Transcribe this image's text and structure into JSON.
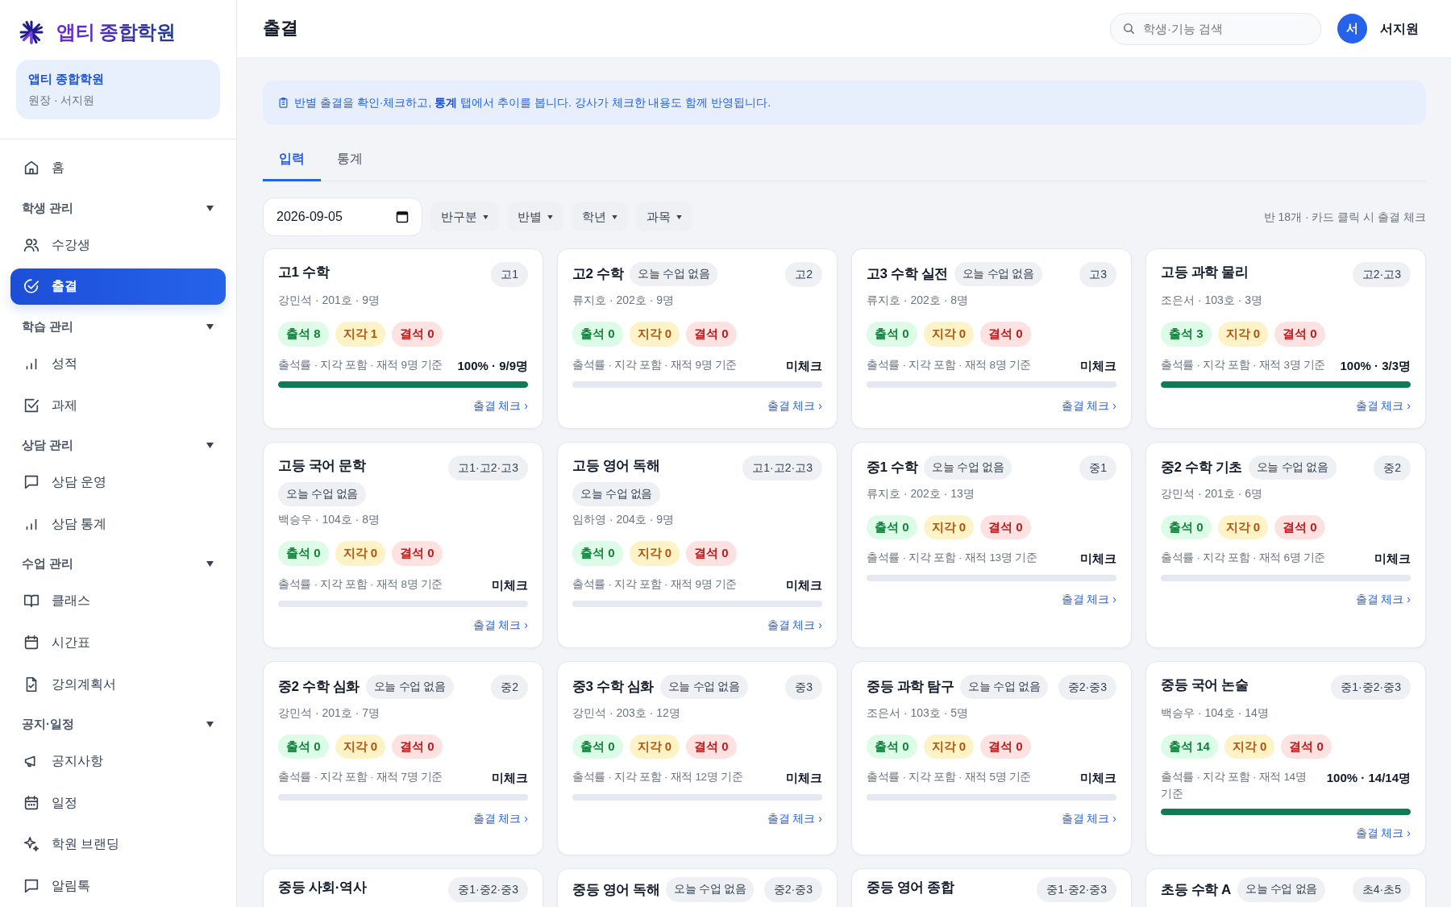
{
  "sidebar": {
    "logo": "앱티 종합학원",
    "org": {
      "name": "앱티 종합학원",
      "role": "원장 · 서지원"
    },
    "nav": [
      {
        "kind": "link",
        "label": "홈",
        "selected": false
      },
      {
        "kind": "section",
        "label": "학생 관리",
        "expanded": true,
        "children": [
          {
            "label": "수강생",
            "selected": false
          },
          {
            "label": "출결",
            "selected": true
          }
        ]
      },
      {
        "kind": "section",
        "label": "학습 관리",
        "expanded": true,
        "children": [
          {
            "label": "성적",
            "selected": false
          },
          {
            "label": "과제",
            "selected": false
          }
        ]
      },
      {
        "kind": "section",
        "label": "상담 관리",
        "expanded": true,
        "children": [
          {
            "label": "상담 운영",
            "selected": false
          },
          {
            "label": "상담 통계",
            "selected": false
          }
        ]
      },
      {
        "kind": "section",
        "label": "수업 관리",
        "expanded": true,
        "children": [
          {
            "label": "클래스",
            "selected": false
          },
          {
            "label": "시간표",
            "selected": false
          },
          {
            "label": "강의계획서",
            "selected": false
          }
        ]
      },
      {
        "kind": "section",
        "label": "공지·일정",
        "expanded": true,
        "children": [
          {
            "label": "공지사항",
            "selected": false
          },
          {
            "label": "일정",
            "selected": false
          },
          {
            "label": "학원 브랜딩",
            "selected": false
          },
          {
            "label": "알림톡",
            "selected": false
          }
        ]
      }
    ]
  },
  "header": {
    "title": "출결",
    "search": {
      "placeholder": "학생·기능 검색"
    },
    "user": {
      "avatar": "서",
      "name": "서지원"
    }
  },
  "notice": "반별 출결을 확인·체크하고, **통계** 탭에서 추이를 봅니다. 강사가 체크한 내용도 함께 반영됩니다.",
  "tabs": [
    {
      "label": "입력",
      "selected": true
    },
    {
      "label": "통계",
      "selected": false
    }
  ],
  "filters": {
    "date": "2026-09-05",
    "dropdowns": [
      "반구분",
      "반별",
      "학년",
      "과목"
    ],
    "summary": "반 18개 · 카드 클릭 시 출결 체크"
  },
  "cards": [
    {
      "title": "고1 수학",
      "grade": "고1",
      "meta": "강민석 · 201호 · 9명",
      "counts": [
        {
          "kind": "present",
          "text": "출석 8"
        },
        {
          "kind": "late",
          "text": "지각 1"
        },
        {
          "kind": "absent",
          "text": "결석 0"
        }
      ],
      "basis": "출석률 · 지각 포함 · 재적 9명 기준",
      "result": "100% · 9/9명",
      "level": 1,
      "link": "출결 체크 ›"
    },
    {
      "title": "고2 수학",
      "note": "오늘 수업 없음",
      "grade": "고2",
      "meta": "류지호 · 202호 · 9명",
      "counts": [
        {
          "kind": "present",
          "text": "출석 0"
        },
        {
          "kind": "late",
          "text": "지각 0"
        },
        {
          "kind": "absent",
          "text": "결석 0"
        }
      ],
      "basis": "출석률 · 지각 포함 · 재적 9명 기준",
      "result": "미체크",
      "level": 0,
      "link": "출결 체크 ›"
    },
    {
      "title": "고3 수학 실전",
      "note": "오늘 수업 없음",
      "grade": "고3",
      "meta": "류지호 · 202호 · 8명",
      "counts": [
        {
          "kind": "present",
          "text": "출석 0"
        },
        {
          "kind": "late",
          "text": "지각 0"
        },
        {
          "kind": "absent",
          "text": "결석 0"
        }
      ],
      "basis": "출석률 · 지각 포함 · 재적 8명 기준",
      "result": "미체크",
      "level": 0,
      "link": "출결 체크 ›"
    },
    {
      "title": "고등 과학 물리",
      "grade": "고2·고3",
      "meta": "조은서 · 103호 · 3명",
      "counts": [
        {
          "kind": "present",
          "text": "출석 3"
        },
        {
          "kind": "late",
          "text": "지각 0"
        },
        {
          "kind": "absent",
          "text": "결석 0"
        }
      ],
      "basis": "출석률 · 지각 포함 · 재적 3명 기준",
      "result": "100% · 3/3명",
      "level": 1,
      "link": "출결 체크 ›"
    },
    {
      "title": "고등 국어 문학",
      "note": "오늘 수업 없음",
      "grade": "고1·고2·고3",
      "meta": "백승우 · 104호 · 8명",
      "counts": [
        {
          "kind": "present",
          "text": "출석 0"
        },
        {
          "kind": "late",
          "text": "지각 0"
        },
        {
          "kind": "absent",
          "text": "결석 0"
        }
      ],
      "basis": "출석률 · 지각 포함 · 재적 8명 기준",
      "result": "미체크",
      "level": 0,
      "link": "출결 체크 ›"
    },
    {
      "title": "고등 영어 독해",
      "note": "오늘 수업 없음",
      "grade": "고1·고2·고3",
      "meta": "임하영 · 204호 · 9명",
      "counts": [
        {
          "kind": "present",
          "text": "출석 0"
        },
        {
          "kind": "late",
          "text": "지각 0"
        },
        {
          "kind": "absent",
          "text": "결석 0"
        }
      ],
      "basis": "출석률 · 지각 포함 · 재적 9명 기준",
      "result": "미체크",
      "level": 0,
      "link": "출결 체크 ›"
    },
    {
      "title": "중1 수학",
      "note": "오늘 수업 없음",
      "grade": "중1",
      "meta": "류지호 · 202호 · 13명",
      "counts": [
        {
          "kind": "present",
          "text": "출석 0"
        },
        {
          "kind": "late",
          "text": "지각 0"
        },
        {
          "kind": "absent",
          "text": "결석 0"
        }
      ],
      "basis": "출석률 · 지각 포함 · 재적 13명 기준",
      "result": "미체크",
      "level": 0,
      "link": "출결 체크 ›"
    },
    {
      "title": "중2 수학 기초",
      "note": "오늘 수업 없음",
      "grade": "중2",
      "meta": "강민석 · 201호 · 6명",
      "counts": [
        {
          "kind": "present",
          "text": "출석 0"
        },
        {
          "kind": "late",
          "text": "지각 0"
        },
        {
          "kind": "absent",
          "text": "결석 0"
        }
      ],
      "basis": "출석률 · 지각 포함 · 재적 6명 기준",
      "result": "미체크",
      "level": 0,
      "link": "출결 체크 ›"
    },
    {
      "title": "중2 수학 심화",
      "note": "오늘 수업 없음",
      "grade": "중2",
      "meta": "강민석 · 201호 · 7명",
      "counts": [
        {
          "kind": "present",
          "text": "출석 0"
        },
        {
          "kind": "late",
          "text": "지각 0"
        },
        {
          "kind": "absent",
          "text": "결석 0"
        }
      ],
      "basis": "출석률 · 지각 포함 · 재적 7명 기준",
      "result": "미체크",
      "level": 0,
      "link": "출결 체크 ›"
    },
    {
      "title": "중3 수학 심화",
      "note": "오늘 수업 없음",
      "grade": "중3",
      "meta": "강민석 · 203호 · 12명",
      "counts": [
        {
          "kind": "present",
          "text": "출석 0"
        },
        {
          "kind": "late",
          "text": "지각 0"
        },
        {
          "kind": "absent",
          "text": "결석 0"
        }
      ],
      "basis": "출석률 · 지각 포함 · 재적 12명 기준",
      "result": "미체크",
      "level": 0,
      "link": "출결 체크 ›"
    },
    {
      "title": "중등 과학 탐구",
      "note": "오늘 수업 없음",
      "grade": "중2·중3",
      "meta": "조은서 · 103호 · 5명",
      "counts": [
        {
          "kind": "present",
          "text": "출석 0"
        },
        {
          "kind": "late",
          "text": "지각 0"
        },
        {
          "kind": "absent",
          "text": "결석 0"
        }
      ],
      "basis": "출석률 · 지각 포함 · 재적 5명 기준",
      "result": "미체크",
      "level": 0,
      "link": "출결 체크 ›"
    },
    {
      "title": "중등 국어 논술",
      "grade": "중1·중2·중3",
      "meta": "백승우 · 104호 · 14명",
      "counts": [
        {
          "kind": "present",
          "text": "출석 14"
        },
        {
          "kind": "late",
          "text": "지각 0"
        },
        {
          "kind": "absent",
          "text": "결석 0"
        }
      ],
      "basis": "출석률 · 지각 포함 · 재적 14명 기준",
      "result": "100% · 14/14명",
      "level": 1,
      "link": "출결 체크 ›"
    },
    {
      "title": "중등 사회·역사",
      "grade": "중1·중2·중3"
    },
    {
      "title": "중등 영어 독해",
      "note": "오늘 수업 없음",
      "grade": "중2·중3"
    },
    {
      "title": "중등 영어 종합",
      "grade": "중1·중2·중3"
    },
    {
      "title": "초등 수학 A",
      "note": "오늘 수업 없음",
      "grade": "초4·초5"
    }
  ]
}
